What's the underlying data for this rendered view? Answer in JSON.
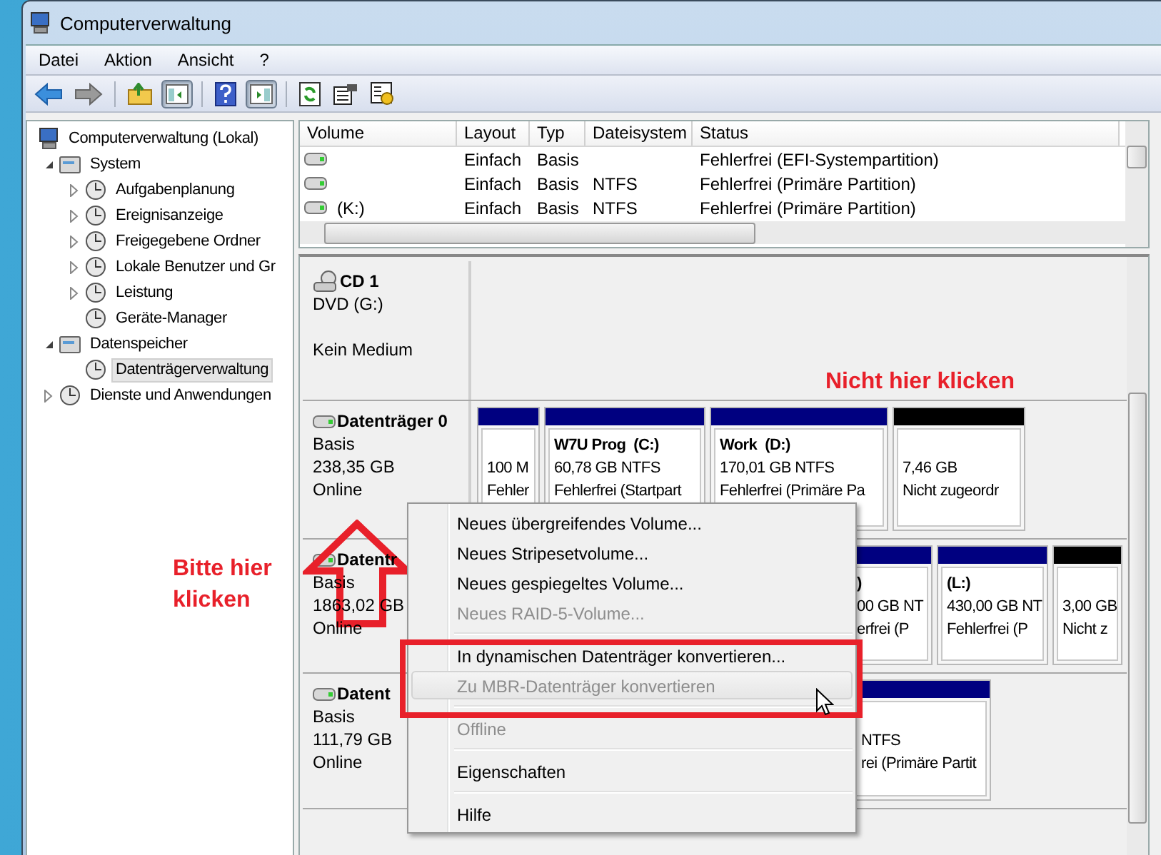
{
  "window": {
    "title": "Computerverwaltung"
  },
  "menu": [
    "Datei",
    "Aktion",
    "Ansicht",
    "?"
  ],
  "toolbar": {
    "console_tree_pressed": true,
    "action_pane_pressed": true
  },
  "tree": [
    {
      "label": "Computerverwaltung (Lokal)",
      "selected": false,
      "children": [
        {
          "label": "System",
          "expanded": true,
          "selected": false,
          "children": [
            {
              "label": "Aufgabenplanung",
              "expanded": false,
              "selected": false
            },
            {
              "label": "Ereignisanzeige",
              "expanded": false,
              "selected": false
            },
            {
              "label": "Freigegebene Ordner",
              "expanded": false,
              "selected": false
            },
            {
              "label": "Lokale Benutzer und Gr",
              "expanded": false,
              "selected": false
            },
            {
              "label": "Leistung",
              "expanded": false,
              "selected": false
            },
            {
              "label": "Geräte-Manager",
              "selected": false
            }
          ]
        },
        {
          "label": "Datenspeicher",
          "expanded": true,
          "selected": false,
          "children": [
            {
              "label": "Datenträgerverwaltung",
              "selected": true
            }
          ]
        },
        {
          "label": "Dienste und Anwendungen",
          "expanded": false,
          "selected": false
        }
      ]
    }
  ],
  "volume_table": {
    "columns": [
      "Volume",
      "Layout",
      "Typ",
      "Dateisystem",
      "Status"
    ],
    "rows": [
      {
        "layout": "Einfach",
        "type": "Basis",
        "status": "Fehlerfrei (EFI-Systempartition)"
      },
      {
        "layout": "Einfach",
        "type": "Basis",
        "file_system": "NTFS",
        "status": "Fehlerfrei (Primäre Partition)"
      },
      {
        "volume": "(K:)",
        "layout": "Einfach",
        "type": "Basis",
        "file_system": "NTFS",
        "status": "Fehlerfrei (Primäre Partition)"
      }
    ]
  },
  "disks": [
    {
      "kind": "cd",
      "name": "CD 1",
      "type": "DVD (G:)",
      "status": "Kein Medium"
    },
    {
      "kind": "disk",
      "name": "Datenträger 0",
      "type": "Basis",
      "size": "238,35 GB",
      "status": "Online",
      "partitions": [
        {
          "kind": "primary",
          "size": "100 M",
          "status": "Fehler"
        },
        {
          "kind": "primary",
          "title": "W7U Prog  (C:)",
          "size": "60,78 GB NTFS",
          "status": "Fehlerfrei (Startpart"
        },
        {
          "kind": "primary",
          "title": "Work  (D:)",
          "size": "170,01 GB NTFS",
          "status": "Fehlerfrei (Primäre Pa"
        },
        {
          "kind": "unallocated",
          "size": "7,46 GB",
          "status": "Nicht zugeordr"
        }
      ]
    },
    {
      "kind": "disk",
      "name": "Datentr",
      "type": "Basis",
      "size": "1863,02 GB",
      "status": "Online",
      "partitions": [
        {
          "kind": "primary",
          "title": ")",
          "size": "00 GB NT",
          "status": "erfrei (P"
        },
        {
          "kind": "primary",
          "title": "(L:)",
          "size": "430,00 GB NT",
          "status": "Fehlerfrei (P"
        },
        {
          "kind": "unallocated",
          "size": "3,00 GB",
          "status": "Nicht z"
        }
      ]
    },
    {
      "kind": "disk",
      "name": "Datent",
      "type": "Basis",
      "size": "111,79 GB",
      "status": "Online",
      "partitions": [
        {
          "kind": "primary",
          "size": "NTFS",
          "status": "rei (Primäre Partit"
        }
      ]
    }
  ],
  "context_menu": [
    {
      "kind": "item",
      "label": "Neues übergreifendes Volume...",
      "disabled": false,
      "selected": false
    },
    {
      "kind": "item",
      "label": "Neues Stripesetvolume...",
      "disabled": false,
      "selected": false
    },
    {
      "kind": "item",
      "label": "Neues gespiegeltes Volume...",
      "disabled": false,
      "selected": false
    },
    {
      "kind": "item",
      "label": "Neues RAID-5-Volume...",
      "disabled": true,
      "selected": false
    },
    {
      "kind": "separator"
    },
    {
      "kind": "item",
      "label": "In dynamischen Datenträger konvertieren...",
      "disabled": false,
      "selected": false
    },
    {
      "kind": "item",
      "label": "Zu MBR-Datenträger konvertieren",
      "disabled": true,
      "selected": true
    },
    {
      "kind": "separator"
    },
    {
      "kind": "item",
      "label": "Offline",
      "disabled": true,
      "selected": false
    },
    {
      "kind": "separator"
    },
    {
      "kind": "item",
      "label": "Eigenschaften",
      "disabled": false,
      "selected": false
    },
    {
      "kind": "separator"
    },
    {
      "kind": "item",
      "label": "Hilfe",
      "disabled": false,
      "selected": false
    }
  ],
  "annotations": {
    "warning_text": "Nicht hier klicken",
    "hint_text": "Bitte hier klicken"
  }
}
